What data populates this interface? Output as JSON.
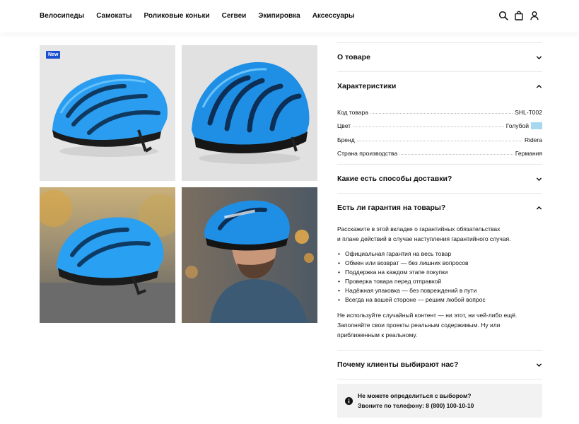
{
  "nav": {
    "items": [
      "Велосипеды",
      "Самокаты",
      "Роликовые коньки",
      "Сегвеи",
      "Экипировка",
      "Аксессуары"
    ]
  },
  "header_icons": [
    "search-icon",
    "bag-icon",
    "user-icon"
  ],
  "gallery": {
    "badge": "New",
    "images": [
      "helmet-side-view",
      "helmet-front-view",
      "helmet-on-street",
      "man-wearing-helmet"
    ]
  },
  "accordions": {
    "about": {
      "title": "О товаре",
      "state": "collapsed"
    },
    "specs": {
      "title": "Характеристики",
      "state": "expanded",
      "rows": [
        {
          "key": "Код товара",
          "value": "SHL-T002"
        },
        {
          "key": "Цвет",
          "value": "Голубой",
          "swatch": "#a8d8f0"
        },
        {
          "key": "Бренд",
          "value": "Ridera"
        },
        {
          "key": "Страна производства",
          "value": "Германия"
        }
      ]
    },
    "delivery": {
      "title": "Какие есть способы доставки?",
      "state": "collapsed"
    },
    "warranty": {
      "title": "Есть ли гарантия на товары?",
      "state": "expanded",
      "intro_line1": "Расскажите в этой вкладке о гарантийных обязательствах",
      "intro_line2": "и плане действий в случае наступления гарантийного случая.",
      "bullets": [
        "Официальная гарантия на весь товар",
        "Обмен или возврат — без лишних вопросов",
        "Поддержка на каждом этапе покупки",
        "Проверка товара перед отправкой",
        "Надёжная упаковка — без повреждений в пути",
        "Всегда на вашей стороне — решим любой вопрос"
      ],
      "outro_line1": "Не используйте случайный контент — ни этот, ни чей-либо ещё.",
      "outro_line2": "Заполняйте свои проекты реальным содержимым. Ну или",
      "outro_line3": "приближенным к реальному."
    },
    "why": {
      "title": "Почему клиенты выбирают нас?",
      "state": "collapsed"
    }
  },
  "help": {
    "line1": "Не можете определиться с выбором?",
    "line2": "Звоните по телефону: 8 (800) 100-10-10"
  },
  "colors": {
    "accent_badge": "#1a4fd0",
    "helmet_blue": "#1e90e8"
  }
}
